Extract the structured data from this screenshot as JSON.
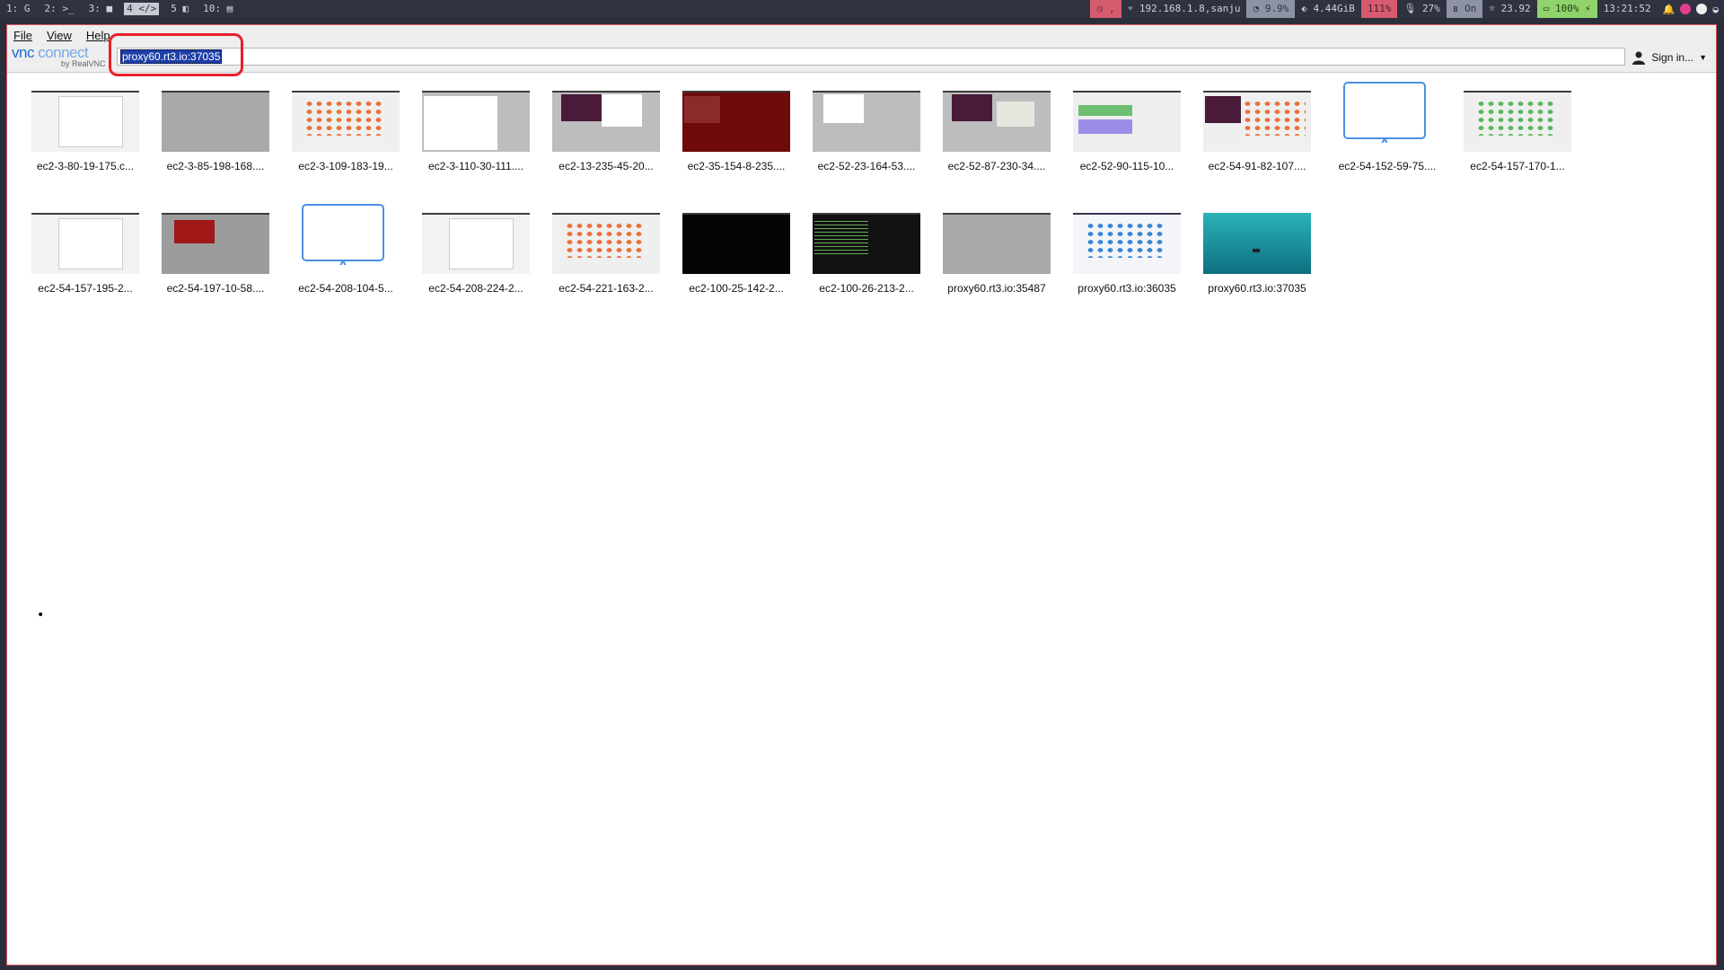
{
  "system_bar": {
    "workspaces": [
      "1: G",
      "2: >_",
      "3: ■",
      "4 </>",
      "5 ◧",
      "10: ▤"
    ],
    "active_workspace": 3,
    "status": {
      "vpn": "⦸ ,",
      "network": "192.168.1.8,sanju",
      "cpu": "9.9%",
      "memory": "4.44GiB",
      "gpu": "111%",
      "mic": "27%",
      "bluetooth": "On",
      "temp": "23.92",
      "battery": "100%",
      "clock": "13:21:52"
    }
  },
  "window": {
    "menu": [
      "File",
      "View",
      "Help"
    ],
    "logo": {
      "line1a": "vnc",
      "line1b": " connect",
      "line2": "by RealVNC"
    },
    "address_value": "proxy60.rt3.io:37035",
    "sign_in": "Sign in..."
  },
  "computers": [
    {
      "label": "ec2-3-80-19-175.c...",
      "thumb": "desktop-light"
    },
    {
      "label": "ec2-3-85-198-168....",
      "thumb": "grey"
    },
    {
      "label": "ec2-3-109-183-19...",
      "thumb": "icons"
    },
    {
      "label": "ec2-3-110-30-111....",
      "thumb": "window-white"
    },
    {
      "label": "ec2-13-235-45-20...",
      "thumb": "purple-window"
    },
    {
      "label": "ec2-35-154-8-235....",
      "thumb": "dark-red"
    },
    {
      "label": "ec2-52-23-164-53....",
      "thumb": "grey-window"
    },
    {
      "label": "ec2-52-87-230-34....",
      "thumb": "purple-grey"
    },
    {
      "label": "ec2-52-90-115-10...",
      "thumb": "colorful"
    },
    {
      "label": "ec2-54-91-82-107....",
      "thumb": "icons-purple"
    },
    {
      "label": "ec2-54-152-59-75....",
      "thumb": "monitor"
    },
    {
      "label": "ec2-54-157-170-1...",
      "thumb": "icons-green"
    },
    {
      "label": "ec2-54-157-195-2...",
      "thumb": "white-page"
    },
    {
      "label": "ec2-54-197-10-58....",
      "thumb": "red-logo"
    },
    {
      "label": "ec2-54-208-104-5...",
      "thumb": "monitor"
    },
    {
      "label": "ec2-54-208-224-2...",
      "thumb": "file-manager"
    },
    {
      "label": "ec2-54-221-163-2...",
      "thumb": "icons"
    },
    {
      "label": "ec2-100-25-142-2...",
      "thumb": "black"
    },
    {
      "label": "ec2-100-26-213-2...",
      "thumb": "terminal"
    },
    {
      "label": "proxy60.rt3.io:35487",
      "thumb": "grey"
    },
    {
      "label": "proxy60.rt3.io:36035",
      "thumb": "blue-icons"
    },
    {
      "label": "proxy60.rt3.io:37035",
      "thumb": "teal-desktop"
    }
  ],
  "bullet": "•"
}
